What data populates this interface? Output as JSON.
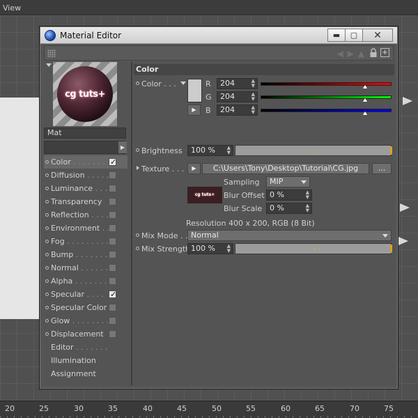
{
  "app": {
    "menu_view": "View"
  },
  "ruler": {
    "ticks": [
      "20",
      "25",
      "30",
      "35",
      "40",
      "45",
      "50",
      "55",
      "60",
      "65",
      "70",
      "75"
    ]
  },
  "window": {
    "title": "Material Editor",
    "btn_minimize": "▬",
    "btn_maximize": "▢",
    "btn_close": "✕"
  },
  "left": {
    "preview_label": "cg tuts+",
    "material_name": "Mat",
    "channels": [
      {
        "label": "Color",
        "dots": " . . . . . . .",
        "checked": true,
        "has_check": true,
        "has_dot": true,
        "active": true
      },
      {
        "label": "Diffusion",
        "dots": " . . . . .",
        "checked": false,
        "has_check": true,
        "has_dot": true
      },
      {
        "label": "Luminance",
        "dots": " . . . .",
        "checked": false,
        "has_check": true,
        "has_dot": true
      },
      {
        "label": "Transparency",
        "dots": "",
        "checked": false,
        "has_check": true,
        "has_dot": true
      },
      {
        "label": "Reflection",
        "dots": " . . . .",
        "checked": false,
        "has_check": true,
        "has_dot": true
      },
      {
        "label": "Environment",
        "dots": " . .",
        "checked": false,
        "has_check": true,
        "has_dot": true
      },
      {
        "label": "Fog",
        "dots": " . . . . . . . . .",
        "checked": false,
        "has_check": true,
        "has_dot": true
      },
      {
        "label": "Bump",
        "dots": " . . . . . . .",
        "checked": false,
        "has_check": true,
        "has_dot": true
      },
      {
        "label": "Normal",
        "dots": " . . . . . .",
        "checked": false,
        "has_check": true,
        "has_dot": true
      },
      {
        "label": "Alpha",
        "dots": " . . . . . . .",
        "checked": false,
        "has_check": true,
        "has_dot": true
      },
      {
        "label": "Specular",
        "dots": " . . . .",
        "checked": true,
        "has_check": true,
        "has_dot": true
      },
      {
        "label": "Specular Color",
        "dots": "",
        "checked": false,
        "has_check": true,
        "has_dot": true
      },
      {
        "label": "Glow",
        "dots": " . . . . . . . .",
        "checked": false,
        "has_check": true,
        "has_dot": true
      },
      {
        "label": "Displacement",
        "dots": "",
        "checked": false,
        "has_check": true,
        "has_dot": true
      },
      {
        "label": "Editor",
        "dots": " . . . . . . .",
        "has_check": false,
        "has_dot": false
      },
      {
        "label": "Illumination",
        "dots": "",
        "has_check": false,
        "has_dot": false
      },
      {
        "label": "Assignment",
        "dots": "",
        "has_check": false,
        "has_dot": false
      }
    ]
  },
  "color": {
    "section_title": "Color",
    "color_label": "Color . . .",
    "r_label": "R",
    "g_label": "G",
    "b_label": "B",
    "r_value": "204",
    "g_value": "204",
    "b_value": "204",
    "r_fraction": 0.8,
    "g_fraction": 0.8,
    "b_fraction": 0.8,
    "swatch_color": "#cccccc",
    "brightness_label": "Brightness",
    "brightness_value": "100 %",
    "texture_label": "Texture . . .",
    "texture_path": "C:\\Users\\Tony\\Desktop\\Tutorial\\CG.jpg",
    "texture_more": "...",
    "sampling_label": "Sampling",
    "sampling_value": "MIP",
    "blur_offset_label": "Blur Offset",
    "blur_offset_value": "0 %",
    "blur_scale_label": "Blur Scale",
    "blur_scale_value": "0 %",
    "thumb_label": "cg tuts+",
    "resolution_text": "Resolution 400 x 200, RGB (8 Bit)",
    "mix_mode_label": "Mix Mode . .",
    "mix_mode_value": "Normal",
    "mix_strength_label": "Mix Strength",
    "mix_strength_value": "100 %"
  }
}
